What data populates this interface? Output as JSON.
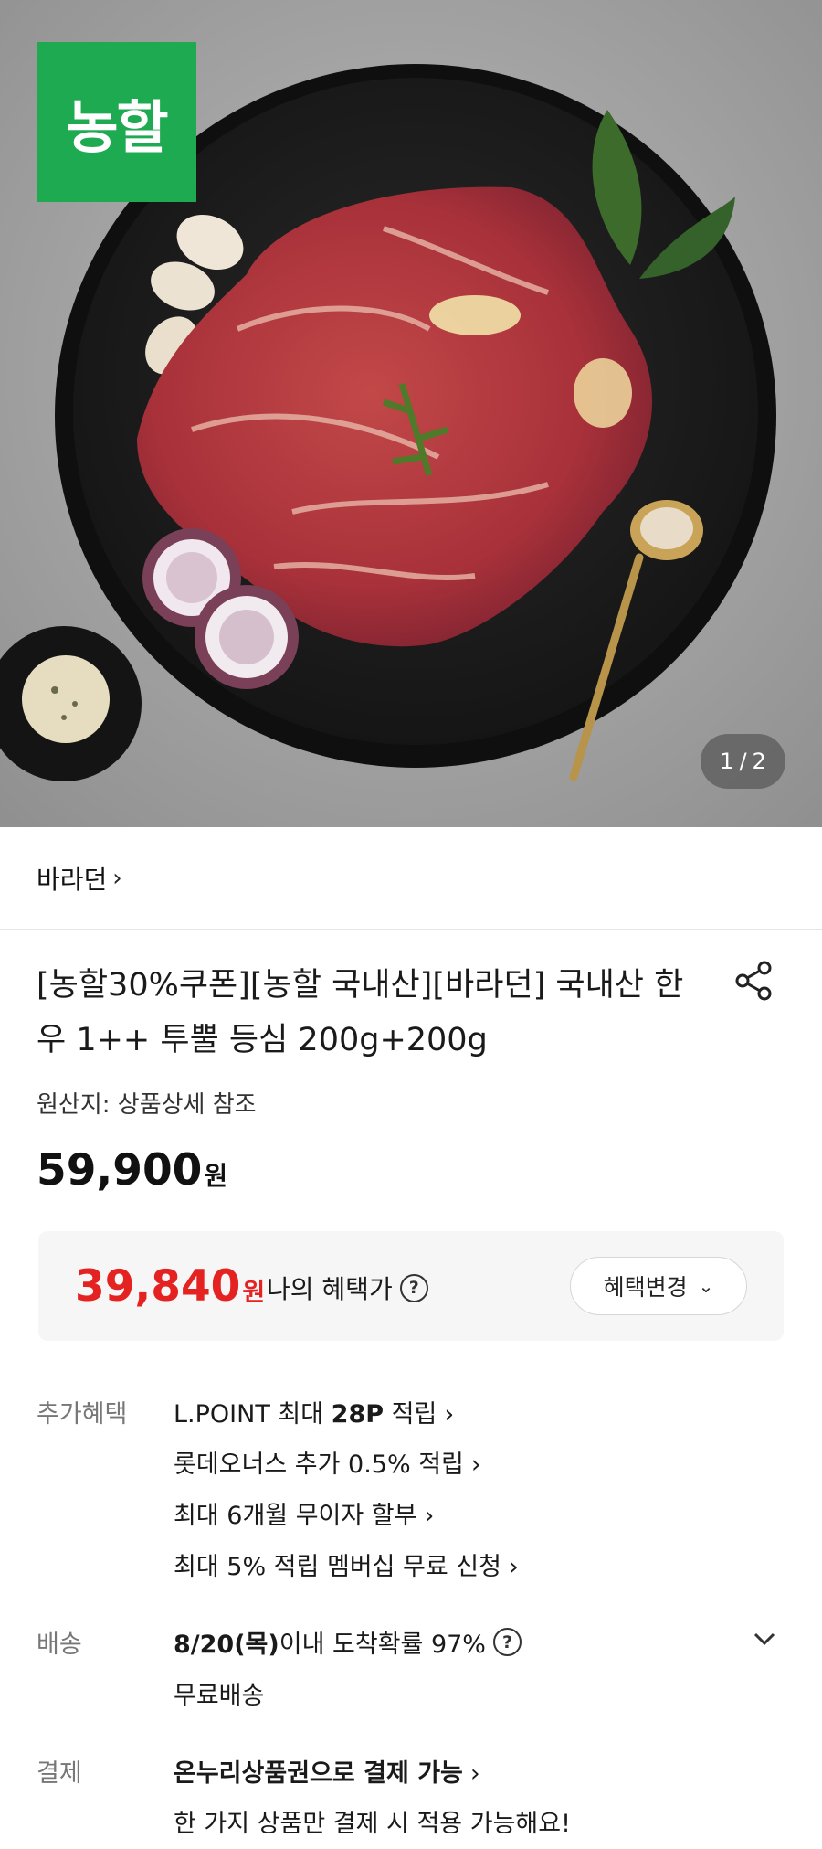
{
  "hero": {
    "brand_badge": "농할",
    "counter_current": "1",
    "counter_total": "2"
  },
  "brand": {
    "name": "바라던",
    "chevron": "›"
  },
  "product": {
    "title": "[농할30%쿠폰][농할 국내산][바라던] 국내산 한우 1++ 투뿔 등심 200g+200g",
    "origin": "원산지: 상품상세 참조",
    "price": "59,900",
    "price_unit": "원"
  },
  "benefit": {
    "price": "39,840",
    "unit": "원",
    "label": "나의 혜택가",
    "change_button": "혜택변경",
    "accent_color": "#e52222"
  },
  "extra": {
    "label": "추가혜택",
    "lines": [
      {
        "pre": "L.POINT 최대 ",
        "bold": "28P",
        "post": " 적립"
      },
      {
        "pre": "롯데오너스 추가 0.5% 적립",
        "bold": "",
        "post": ""
      },
      {
        "pre": "최대 6개월 무이자 할부",
        "bold": "",
        "post": ""
      },
      {
        "pre": "최대 5% 적립 멤버십 무료 신청",
        "bold": "",
        "post": ""
      }
    ]
  },
  "delivery": {
    "label": "배송",
    "date": "8/20(목)",
    "rest": " 이내 도착확률 97%",
    "free": "무료배송"
  },
  "payment": {
    "label": "결제",
    "line1": "온누리상품권으로 결제 가능",
    "line2": "한 가지 상품만 결제 시 적용 가능해요!"
  },
  "icons": {
    "share": "share-icon",
    "question": "question-circle-icon",
    "chevron_right": "chevron-right-icon",
    "chevron_down": "chevron-down-icon"
  },
  "colors": {
    "brand_green": "#1daa50",
    "price_red": "#e52222"
  }
}
